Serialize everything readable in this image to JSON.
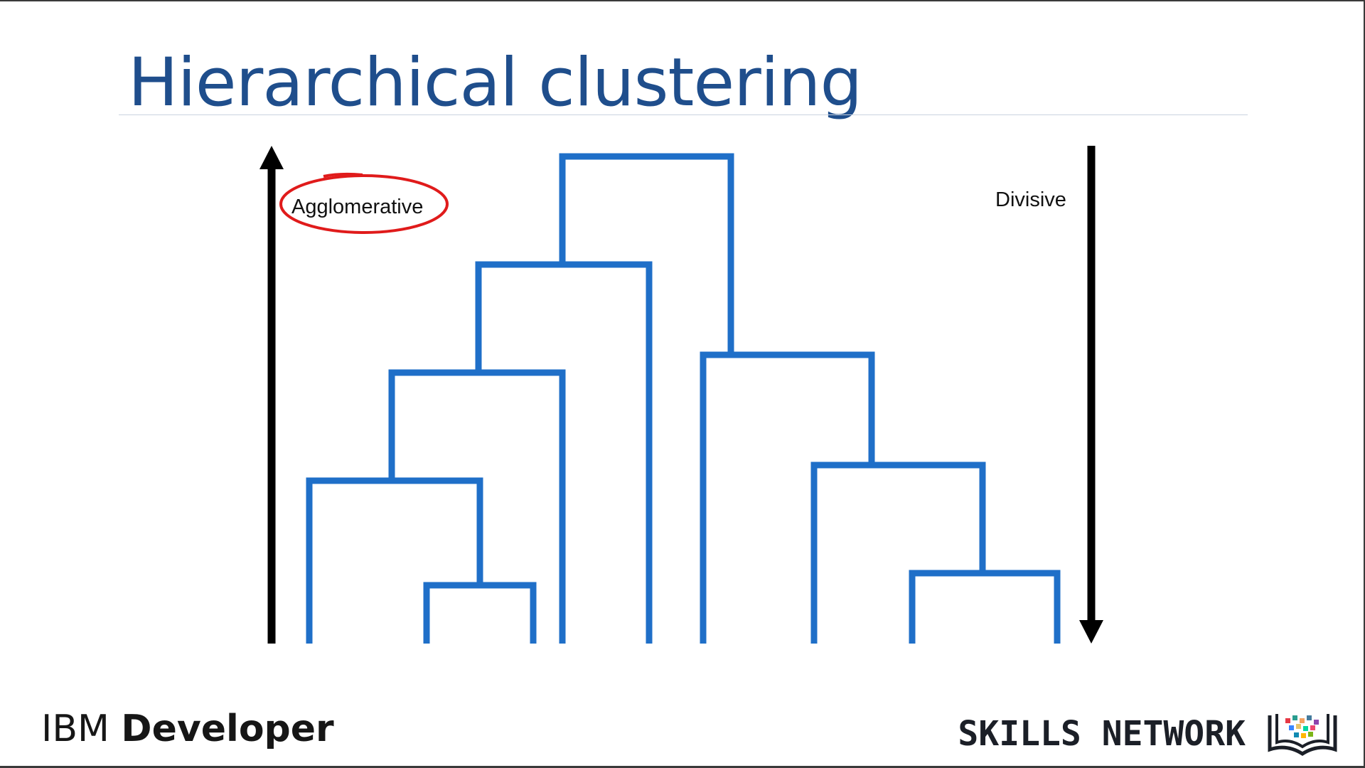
{
  "slide": {
    "title": "Hierarchical clustering"
  },
  "diagram": {
    "labels": {
      "agglomerative": "Agglomerative",
      "divisive": "Divisive"
    },
    "colors": {
      "dendrogram": "#1f6fc8",
      "arrow": "#000000",
      "highlight_circle": "#e01b1b"
    }
  },
  "footer": {
    "brand_part1": "IBM ",
    "brand_part2": "Developer",
    "skills_network": "SKILLS NETWORK"
  }
}
